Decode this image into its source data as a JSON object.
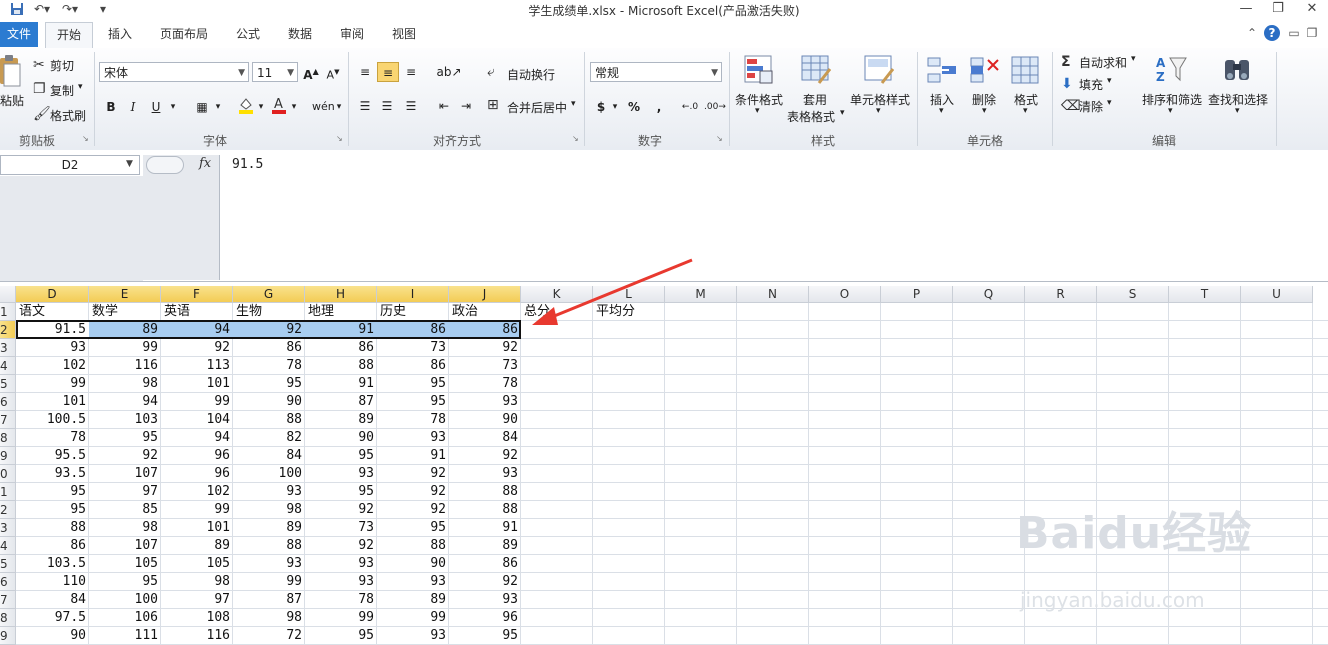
{
  "window": {
    "title": "学生成绩单.xlsx  -  Microsoft Excel(产品激活失败)"
  },
  "ribbon_tabs": [
    "文件",
    "开始",
    "插入",
    "页面布局",
    "公式",
    "数据",
    "审阅",
    "视图"
  ],
  "clipboard": {
    "paste_label": "粘贴",
    "cut_label": "剪切",
    "copy_label": "复制",
    "format_painter_label": "格式刷",
    "group_label": "剪贴板"
  },
  "font_group": {
    "font_name": "宋体",
    "font_size": "11",
    "bold": "B",
    "italic": "I",
    "underline": "U",
    "group_label": "字体"
  },
  "alignment": {
    "wrap_text_label": "自动换行",
    "merge_center_label": "合并后居中",
    "group_label": "对齐方式"
  },
  "number": {
    "format_value": "常规",
    "currency": "$",
    "percent": "%",
    "comma": ",",
    "group_label": "数字"
  },
  "styles": {
    "conditional_format_label": "条件格式",
    "table_format_label1": "套用",
    "table_format_label2": "表格格式",
    "cell_styles_label": "单元格样式",
    "group_label": "样式"
  },
  "cells_group": {
    "insert_label": "插入",
    "delete_label": "删除",
    "format_label": "格式",
    "group_label": "单元格"
  },
  "editing": {
    "autosum_label": "自动求和",
    "fill_label": "填充",
    "clear_label": "清除",
    "sort_filter_label": "排序和筛选",
    "find_select_label": "查找和选择",
    "group_label": "编辑"
  },
  "formula_bar": {
    "name_box": "D2",
    "fx": "fx",
    "value": "91.5"
  },
  "sheet": {
    "columns": [
      "D",
      "E",
      "F",
      "G",
      "H",
      "I",
      "J",
      "K",
      "L",
      "M",
      "N",
      "O",
      "P",
      "Q",
      "R",
      "S",
      "T",
      "U"
    ],
    "row_numbers": [
      "1",
      "2",
      "3",
      "4",
      "5",
      "6",
      "7",
      "8",
      "9",
      "0",
      "1",
      "2",
      "3",
      "4",
      "5",
      "6",
      "7",
      "8",
      "9"
    ],
    "header_row": [
      "语文",
      "数学",
      "英语",
      "生物",
      "地理",
      "历史",
      "政治",
      "总分",
      "平均分"
    ],
    "rows": [
      [
        "91.5",
        "89",
        "94",
        "92",
        "91",
        "86",
        "86"
      ],
      [
        "93",
        "99",
        "92",
        "86",
        "86",
        "73",
        "92"
      ],
      [
        "102",
        "116",
        "113",
        "78",
        "88",
        "86",
        "73"
      ],
      [
        "99",
        "98",
        "101",
        "95",
        "91",
        "95",
        "78"
      ],
      [
        "101",
        "94",
        "99",
        "90",
        "87",
        "95",
        "93"
      ],
      [
        "100.5",
        "103",
        "104",
        "88",
        "89",
        "78",
        "90"
      ],
      [
        "78",
        "95",
        "94",
        "82",
        "90",
        "93",
        "84"
      ],
      [
        "95.5",
        "92",
        "96",
        "84",
        "95",
        "91",
        "92"
      ],
      [
        "93.5",
        "107",
        "96",
        "100",
        "93",
        "92",
        "93"
      ],
      [
        "95",
        "97",
        "102",
        "93",
        "95",
        "92",
        "88"
      ],
      [
        "95",
        "85",
        "99",
        "98",
        "92",
        "92",
        "88"
      ],
      [
        "88",
        "98",
        "101",
        "89",
        "73",
        "95",
        "91"
      ],
      [
        "86",
        "107",
        "89",
        "88",
        "92",
        "88",
        "89"
      ],
      [
        "103.5",
        "105",
        "105",
        "93",
        "93",
        "90",
        "86"
      ],
      [
        "110",
        "95",
        "98",
        "99",
        "93",
        "93",
        "92"
      ],
      [
        "84",
        "100",
        "97",
        "87",
        "78",
        "89",
        "93"
      ],
      [
        "97.5",
        "106",
        "108",
        "98",
        "99",
        "99",
        "96"
      ],
      [
        "90",
        "111",
        "116",
        "72",
        "95",
        "93",
        "95"
      ]
    ]
  },
  "watermark": {
    "brand": "Baidu经验",
    "url": "jingyan.baidu.com"
  },
  "colors": {
    "file_tab": "#2b7bd1",
    "selection_band": "#a8cdf0",
    "selected_header": "#f3cc55",
    "annotation_arrow": "#e8392f"
  }
}
